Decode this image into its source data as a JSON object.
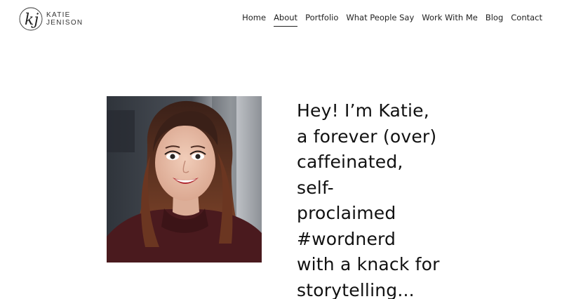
{
  "logo": {
    "initials": "kj",
    "line1": "KATIE",
    "line2": "JENISON"
  },
  "nav": {
    "items": [
      {
        "label": "Home",
        "active": false
      },
      {
        "label": "About",
        "active": true
      },
      {
        "label": "Portfolio",
        "active": false
      },
      {
        "label": "What People Say",
        "active": false
      },
      {
        "label": "Work With Me",
        "active": false
      },
      {
        "label": "Blog",
        "active": false
      },
      {
        "label": "Contact",
        "active": false
      }
    ]
  },
  "hero": {
    "lines": [
      "Hey! I’m Katie,",
      "a forever (over)",
      "caffeinated,",
      "self-",
      "proclaimed",
      "#wordnerd",
      "with a knack for",
      "storytelling..."
    ]
  },
  "colors": {
    "text": "#111111",
    "background": "#ffffff",
    "sweater": "#4a1a1e",
    "hair": "#5a2e1e"
  }
}
